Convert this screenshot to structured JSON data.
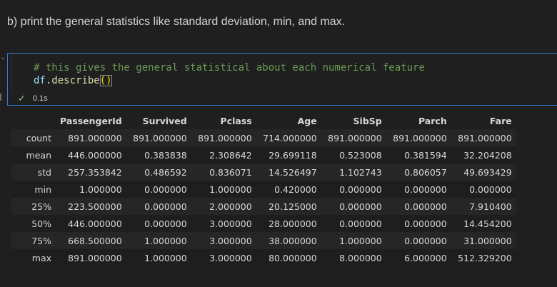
{
  "markdown": {
    "text": "b) print the general statistics like standard deviation, min, and  max."
  },
  "cell": {
    "chevron_icon": "chevron-down-icon",
    "code": {
      "comment": "# this gives the general statistical about each numerical feature",
      "var": "df",
      "dot": ".",
      "method": "describe",
      "parens": "()"
    },
    "status": {
      "icon": "check-icon",
      "check": "✓",
      "time": "0.1s"
    }
  },
  "output": {
    "columns": [
      "",
      "PassengerId",
      "Survived",
      "Pclass",
      "Age",
      "SibSp",
      "Parch",
      "Fare"
    ],
    "rows": [
      [
        "count",
        "891.000000",
        "891.000000",
        "891.000000",
        "714.000000",
        "891.000000",
        "891.000000",
        "891.000000"
      ],
      [
        "mean",
        "446.000000",
        "0.383838",
        "2.308642",
        "29.699118",
        "0.523008",
        "0.381594",
        "32.204208"
      ],
      [
        "std",
        "257.353842",
        "0.486592",
        "0.836071",
        "14.526497",
        "1.102743",
        "0.806057",
        "49.693429"
      ],
      [
        "min",
        "1.000000",
        "0.000000",
        "1.000000",
        "0.420000",
        "0.000000",
        "0.000000",
        "0.000000"
      ],
      [
        "25%",
        "223.500000",
        "0.000000",
        "2.000000",
        "20.125000",
        "0.000000",
        "0.000000",
        "7.910400"
      ],
      [
        "50%",
        "446.000000",
        "0.000000",
        "3.000000",
        "28.000000",
        "0.000000",
        "0.000000",
        "14.454200"
      ],
      [
        "75%",
        "668.500000",
        "1.000000",
        "3.000000",
        "38.000000",
        "1.000000",
        "0.000000",
        "31.000000"
      ],
      [
        "max",
        "891.000000",
        "1.000000",
        "3.000000",
        "80.000000",
        "8.000000",
        "6.000000",
        "512.329200"
      ]
    ]
  },
  "colors": {
    "cell_border": "#2f7fd0",
    "comment": "#6a9955",
    "variable": "#9cdcfe",
    "function": "#dcdcaa",
    "bracket": "#ffd700",
    "success": "#89d185"
  }
}
